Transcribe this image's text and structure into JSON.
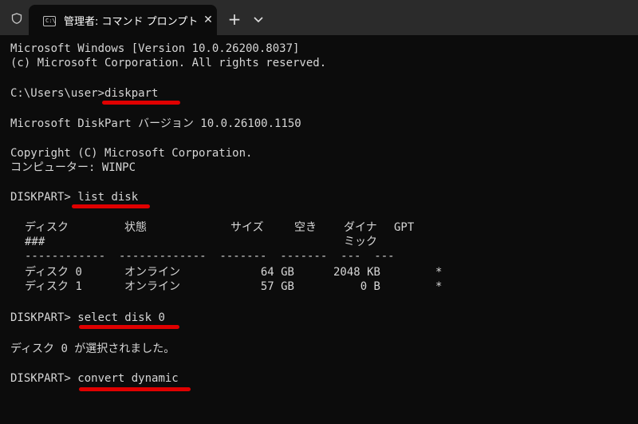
{
  "tab": {
    "title": "管理者: コマンド プロンプト - diskpart",
    "close": "✕",
    "new_tab": "+"
  },
  "terminal": {
    "header_line1": "Microsoft Windows [Version 10.0.26200.8037]",
    "header_line2": "(c) Microsoft Corporation. All rights reserved.",
    "prompt1": "C:\\Users\\user>",
    "cmd1": "diskpart",
    "diskpart_version": "Microsoft DiskPart バージョン 10.0.26100.1150",
    "copyright": "Copyright (C) Microsoft Corporation.",
    "computer": "コンピューター: WINPC",
    "prompt2": "DISKPART> ",
    "cmd2": "list disk",
    "table": {
      "headers": [
        "ディスク",
        "状態",
        "サイズ",
        "空き",
        "ダイナ",
        "GPT"
      ],
      "headers2": [
        "###",
        "ミック"
      ],
      "separator_line": "------------  -------------  -------  -------  ---  ---",
      "rows": [
        [
          "ディスク 0",
          "オンライン",
          "64 GB",
          "2048 KB",
          "",
          "*"
        ],
        [
          "ディスク 1",
          "オンライン",
          "57 GB",
          "0 B",
          "",
          "*"
        ]
      ]
    },
    "prompt3": "DISKPART> ",
    "cmd3": "select disk 0",
    "select_result": "ディスク 0 が選択されました。",
    "prompt4": "DISKPART> ",
    "cmd4": "convert dynamic"
  },
  "colors": {
    "background": "#0c0c0c",
    "text": "#d6d6d6",
    "underline": "#e00000",
    "titlebar": "#2b2b2b"
  }
}
